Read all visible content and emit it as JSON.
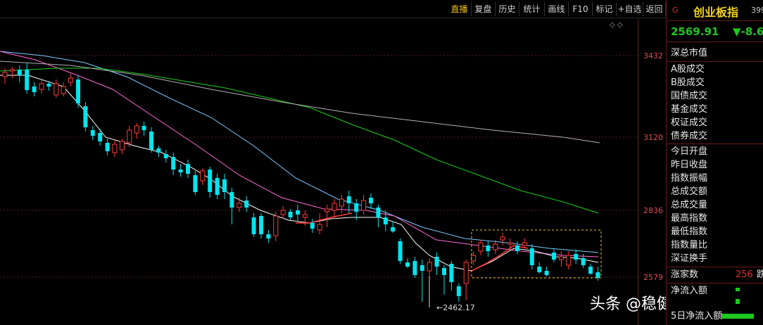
{
  "toolbar": {
    "buttons": [
      "直播",
      "复盘",
      "历史",
      "统计",
      "画线",
      "F10",
      "标记",
      "+自选",
      "返回"
    ],
    "active_index": 0
  },
  "chart": {
    "price_labels": [
      "3432",
      "3120",
      "2836",
      "2579"
    ],
    "low_marker": "2462.17",
    "diamond_controls": "◇◇",
    "colors": {
      "up": "#ff3c3c",
      "down": "#00e5ee",
      "ma5": "#ffffff",
      "ma10": "#f0d020",
      "ma20": "#ff6ad5",
      "ma30": "#7ec8ff",
      "ma60": "#19d119",
      "ma120": "#b0b0b0",
      "box": "#f0d020"
    }
  },
  "watermark": "头条 @稳健投资人",
  "side": {
    "flag": "G",
    "title": "创业板指",
    "code": "399",
    "price": "2569.91",
    "change": "▼-8.6",
    "group1": [
      "深总市值"
    ],
    "group2": [
      "A股成交",
      "B股成交",
      "国债成交",
      "基金成交",
      "权证成交",
      "债券成交"
    ],
    "group3": [
      "今日开盘",
      "昨日收盘",
      "指数振幅",
      "总成交额",
      "总成交量",
      "最高指数",
      "最低指数",
      "指数量比",
      "深证换手"
    ],
    "group4_label": "涨家数",
    "group4_value": "256",
    "group4_suffix": "跌",
    "group5": [
      "净流入额",
      "5日净流入额"
    ]
  }
}
